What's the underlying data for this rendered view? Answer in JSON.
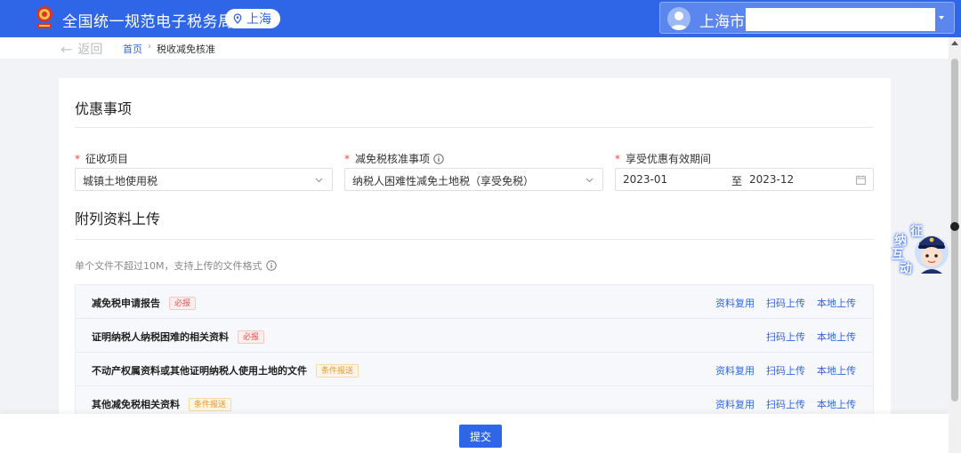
{
  "header": {
    "title": "全国统一规范电子税务局",
    "region": "上海",
    "user_city": "上海市",
    "colors": {
      "brand": "#2f66e8"
    }
  },
  "breadcrumb": {
    "back": "返回",
    "home": "首页",
    "separator": "›",
    "current": "税收减免核准"
  },
  "section1": {
    "title": "优惠事项",
    "fields": [
      {
        "label": "征收项目",
        "value": "城镇土地使用税"
      },
      {
        "label": "减免税核准事项",
        "value": "纳税人困难性减免土地税（享受免税）"
      },
      {
        "label": "享受优惠有效期间",
        "start": "2023-01",
        "to": "至",
        "end": "2023-12"
      }
    ],
    "required_mark": "*"
  },
  "section2": {
    "title": "附列资料上传",
    "hint": "单个文件不超过10M，支持上传的文件格式",
    "rows": [
      {
        "name": "减免税申请报告",
        "tag": "必报",
        "actions": [
          "资料复用",
          "扫码上传",
          "本地上传"
        ]
      },
      {
        "name": "证明纳税人纳税困难的相关资料",
        "tag": "必报",
        "actions": [
          "扫码上传",
          "本地上传"
        ]
      },
      {
        "name": "不动产权属资料或其他证明纳税人使用土地的文件",
        "tag": "条件报送",
        "actions": [
          "资料复用",
          "扫码上传",
          "本地上传"
        ]
      },
      {
        "name": "其他减免税相关资料",
        "tag": "条件报送",
        "actions": [
          "资料复用",
          "扫码上传",
          "本地上传"
        ]
      }
    ]
  },
  "footer": {
    "submit": "提交"
  },
  "widget": {
    "chars": [
      "征",
      "纳",
      "互",
      "动"
    ]
  }
}
